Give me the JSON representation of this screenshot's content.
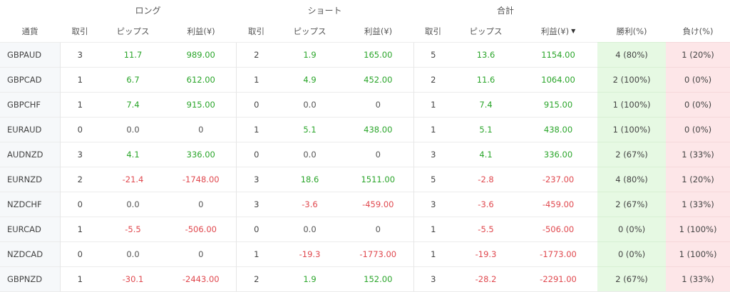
{
  "groups": {
    "long": "ロング",
    "short": "ショート",
    "total": "合計"
  },
  "headers": {
    "symbol": "通貨",
    "long_trades": "取引",
    "long_pips": "ピップス",
    "long_profit": "利益(¥)",
    "short_trades": "取引",
    "short_pips": "ピップス",
    "short_profit": "利益(¥)",
    "total_trades": "取引",
    "total_pips": "ピップス",
    "total_profit": "利益(¥)",
    "win": "勝利(%)",
    "loss": "負け(%)"
  },
  "sort_icon": "▼",
  "colors": {
    "positive": "#2aa52a",
    "negative": "#e0484e",
    "win_bg": "#e6f9e3",
    "loss_bg": "#fde6e8"
  },
  "rows": [
    {
      "symbol": "GBPAUD",
      "long_trades": "3",
      "long_pips": "11.7",
      "long_profit": "989.00",
      "short_trades": "2",
      "short_pips": "1.9",
      "short_profit": "165.00",
      "total_trades": "5",
      "total_pips": "13.6",
      "total_profit": "1154.00",
      "win": "4 (80%)",
      "loss": "1 (20%)"
    },
    {
      "symbol": "GBPCAD",
      "long_trades": "1",
      "long_pips": "6.7",
      "long_profit": "612.00",
      "short_trades": "1",
      "short_pips": "4.9",
      "short_profit": "452.00",
      "total_trades": "2",
      "total_pips": "11.6",
      "total_profit": "1064.00",
      "win": "2 (100%)",
      "loss": "0 (0%)"
    },
    {
      "symbol": "GBPCHF",
      "long_trades": "1",
      "long_pips": "7.4",
      "long_profit": "915.00",
      "short_trades": "0",
      "short_pips": "0.0",
      "short_profit": "0",
      "total_trades": "1",
      "total_pips": "7.4",
      "total_profit": "915.00",
      "win": "1 (100%)",
      "loss": "0 (0%)"
    },
    {
      "symbol": "EURAUD",
      "long_trades": "0",
      "long_pips": "0.0",
      "long_profit": "0",
      "short_trades": "1",
      "short_pips": "5.1",
      "short_profit": "438.00",
      "total_trades": "1",
      "total_pips": "5.1",
      "total_profit": "438.00",
      "win": "1 (100%)",
      "loss": "0 (0%)"
    },
    {
      "symbol": "AUDNZD",
      "long_trades": "3",
      "long_pips": "4.1",
      "long_profit": "336.00",
      "short_trades": "0",
      "short_pips": "0.0",
      "short_profit": "0",
      "total_trades": "3",
      "total_pips": "4.1",
      "total_profit": "336.00",
      "win": "2 (67%)",
      "loss": "1 (33%)"
    },
    {
      "symbol": "EURNZD",
      "long_trades": "2",
      "long_pips": "-21.4",
      "long_profit": "-1748.00",
      "short_trades": "3",
      "short_pips": "18.6",
      "short_profit": "1511.00",
      "total_trades": "5",
      "total_pips": "-2.8",
      "total_profit": "-237.00",
      "win": "4 (80%)",
      "loss": "1 (20%)"
    },
    {
      "symbol": "NZDCHF",
      "long_trades": "0",
      "long_pips": "0.0",
      "long_profit": "0",
      "short_trades": "3",
      "short_pips": "-3.6",
      "short_profit": "-459.00",
      "total_trades": "3",
      "total_pips": "-3.6",
      "total_profit": "-459.00",
      "win": "2 (67%)",
      "loss": "1 (33%)"
    },
    {
      "symbol": "EURCAD",
      "long_trades": "1",
      "long_pips": "-5.5",
      "long_profit": "-506.00",
      "short_trades": "0",
      "short_pips": "0.0",
      "short_profit": "0",
      "total_trades": "1",
      "total_pips": "-5.5",
      "total_profit": "-506.00",
      "win": "0 (0%)",
      "loss": "1 (100%)"
    },
    {
      "symbol": "NZDCAD",
      "long_trades": "0",
      "long_pips": "0.0",
      "long_profit": "0",
      "short_trades": "1",
      "short_pips": "-19.3",
      "short_profit": "-1773.00",
      "total_trades": "1",
      "total_pips": "-19.3",
      "total_profit": "-1773.00",
      "win": "0 (0%)",
      "loss": "1 (100%)"
    },
    {
      "symbol": "GBPNZD",
      "long_trades": "1",
      "long_pips": "-30.1",
      "long_profit": "-2443.00",
      "short_trades": "2",
      "short_pips": "1.9",
      "short_profit": "152.00",
      "total_trades": "3",
      "total_pips": "-28.2",
      "total_profit": "-2291.00",
      "win": "2 (67%)",
      "loss": "1 (33%)"
    }
  ]
}
